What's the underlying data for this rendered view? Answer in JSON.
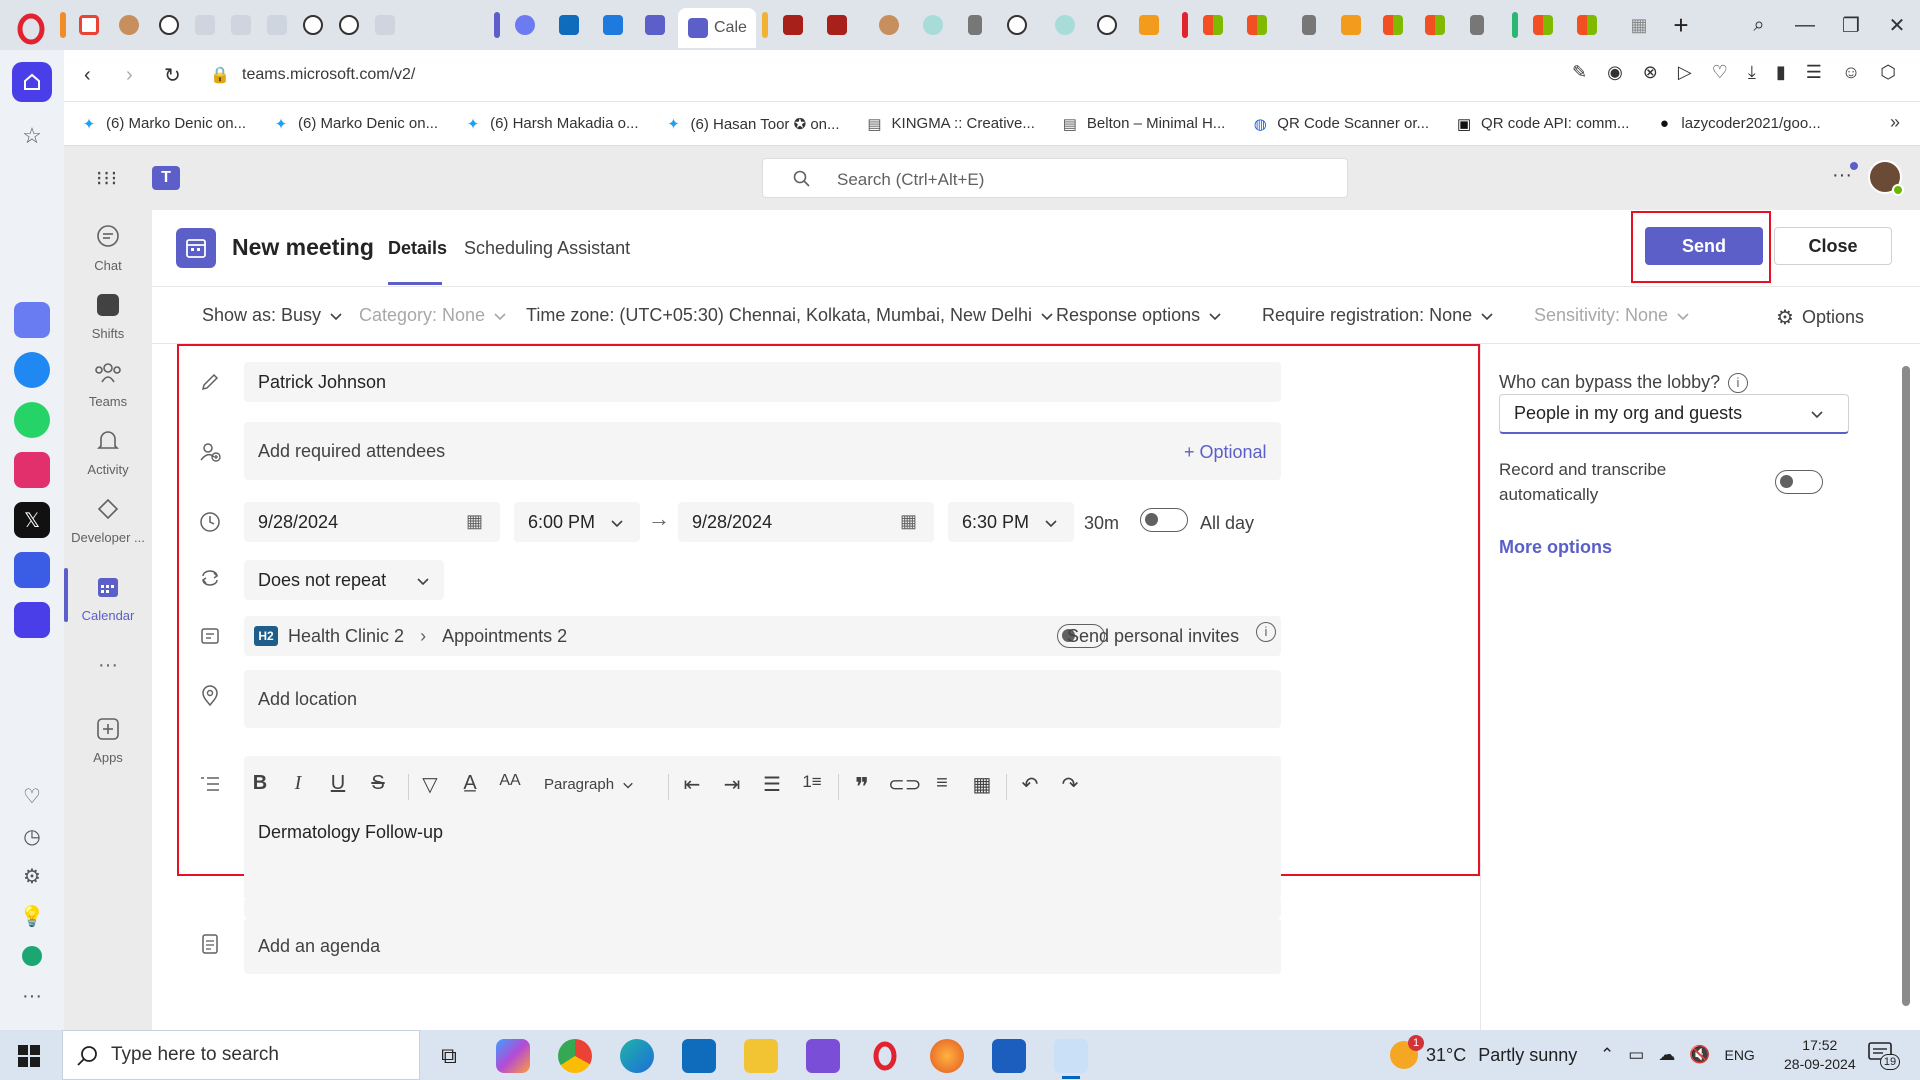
{
  "browser": {
    "active_tab_label": "Cale",
    "url": "teams.microsoft.com/v2/",
    "bookmarks": [
      "(6) Marko Denic on...",
      "(6) Marko Denic on...",
      "(6) Harsh Makadia o...",
      "(6) Hasan Toor ✪ on...",
      "KINGMA :: Creative...",
      "Belton – Minimal H...",
      "QR Code Scanner or...",
      "QR code API: comm...",
      "lazycoder2021/goo..."
    ]
  },
  "teams": {
    "search_placeholder": "Search (Ctrl+Alt+E)",
    "rail": [
      "Chat",
      "Shifts",
      "Teams",
      "Activity",
      "Developer ...",
      "Calendar",
      "Apps"
    ],
    "header": {
      "title": "New meeting",
      "tab_details": "Details",
      "tab_scheduling": "Scheduling Assistant",
      "send": "Send",
      "close": "Close"
    },
    "options": {
      "show_as": "Show as: Busy",
      "category": "Category: None",
      "timezone": "Time zone: (UTC+05:30) Chennai, Kolkata, Mumbai, New Delhi",
      "response": "Response options",
      "registration": "Require registration: None",
      "sensitivity": "Sensitivity: None",
      "options": "Options"
    },
    "form": {
      "title_value": "Patrick Johnson",
      "attendees_placeholder": "Add required attendees",
      "optional": "+ Optional",
      "start_date": "9/28/2024",
      "start_time": "6:00 PM",
      "end_date": "9/28/2024",
      "end_time": "6:30 PM",
      "duration": "30m",
      "all_day": "All day",
      "repeat": "Does not repeat",
      "channel_badge": "H2",
      "channel_team": "Health Clinic 2",
      "channel_name": "Appointments 2",
      "personal_invites": "Send personal invites",
      "location_placeholder": "Add location",
      "paragraph": "Paragraph",
      "body_text": "Dermatology Follow-up",
      "agenda_placeholder": "Add an agenda"
    },
    "right": {
      "lobby_label": "Who can bypass the lobby?",
      "lobby_value": "People in my org and guests",
      "record_line1": "Record and transcribe",
      "record_line2": "automatically",
      "more_options": "More options"
    }
  },
  "taskbar": {
    "search_placeholder": "Type here to search",
    "weather_temp": "31°C",
    "weather_text": "Partly sunny",
    "weather_badge": "1",
    "lang": "ENG",
    "time": "17:52",
    "date": "28-09-2024",
    "notif_count": "19"
  },
  "colors": {
    "accent": "#5b5fc7",
    "highlight": "#e81123"
  }
}
